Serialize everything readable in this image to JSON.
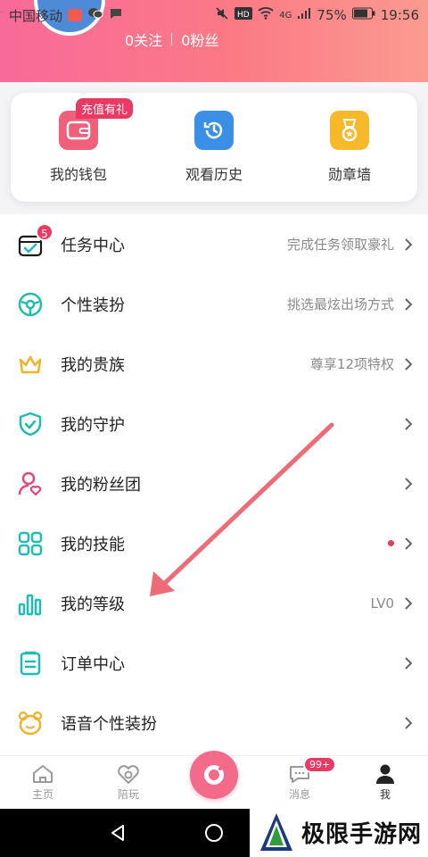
{
  "status_bar": {
    "carrier": "中国移动",
    "network": "4G",
    "battery": "75%",
    "time": "19:56"
  },
  "profile": {
    "follow": "0关注",
    "fans": "0粉丝"
  },
  "quick_actions": [
    {
      "label": "我的钱包",
      "tag": "充值有礼",
      "icon": "wallet-icon",
      "color": "#f0607a"
    },
    {
      "label": "观看历史",
      "icon": "history-clock-icon",
      "color": "#3c8fe6"
    },
    {
      "label": "勋章墙",
      "icon": "medal-icon",
      "color": "#f5b92a"
    }
  ],
  "menu": [
    {
      "label": "任务中心",
      "hint": "完成任务领取豪礼",
      "badge": "5",
      "icon": "task-calendar-icon"
    },
    {
      "label": "个性装扮",
      "hint": "挑选最炫出场方式",
      "icon": "steering-wheel-icon"
    },
    {
      "label": "我的贵族",
      "hint": "尊享12项特权",
      "icon": "crown-icon"
    },
    {
      "label": "我的守护",
      "hint": "",
      "icon": "shield-check-icon"
    },
    {
      "label": "我的粉丝团",
      "hint": "",
      "icon": "user-heart-icon"
    },
    {
      "label": "我的技能",
      "hint": "",
      "icon": "grid-icon",
      "dot": true
    },
    {
      "label": "我的等级",
      "hint": "LV0",
      "icon": "bar-chart-icon"
    },
    {
      "label": "订单中心",
      "hint": "",
      "icon": "clipboard-icon"
    },
    {
      "label": "语音个性装扮",
      "hint": "",
      "icon": "bear-icon"
    }
  ],
  "bottom_nav": [
    {
      "label": "主页",
      "icon": "home-icon"
    },
    {
      "label": "陪玩",
      "icon": "heart-icon"
    },
    {
      "label": "",
      "icon": "live-camera-icon"
    },
    {
      "label": "消息",
      "icon": "chat-icon",
      "badge": "99+"
    },
    {
      "label": "我",
      "icon": "person-icon",
      "active": true
    }
  ],
  "watermark": {
    "text": "极限手游网"
  },
  "colors": {
    "accent_pink": "#f46a8a",
    "teal": "#1fbcb0",
    "badge_red": "#ea3a63"
  }
}
